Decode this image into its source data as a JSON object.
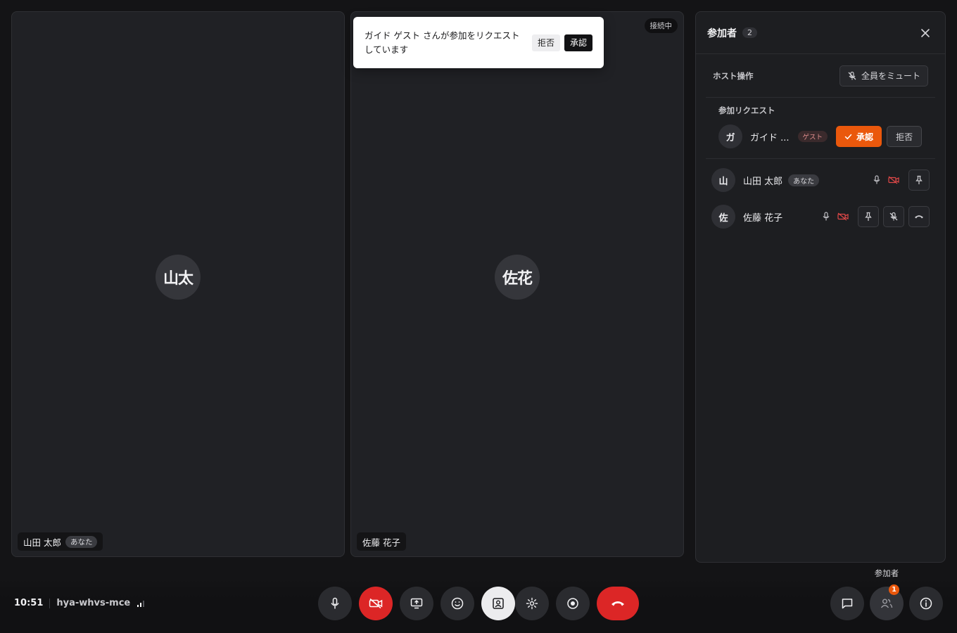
{
  "tiles": [
    {
      "initials": "山太",
      "name": "山田 太郎",
      "you_badge": "あなた"
    },
    {
      "initials": "佐花",
      "name": "佐藤 花子",
      "status": "接続中"
    }
  ],
  "toast": {
    "message": "ガイド ゲスト さんが参加をリクエストしています",
    "reject_label": "拒否",
    "approve_label": "承認"
  },
  "panel": {
    "title": "参加者",
    "count": "2",
    "host_label": "ホスト操作",
    "mute_all_label": "全員をミュート",
    "requests_label": "参加リクエスト",
    "request": {
      "initial": "ガ",
      "name": "ガイド ...",
      "guest_badge": "ゲスト",
      "approve_label": "承認",
      "reject_label": "拒否"
    },
    "participants": [
      {
        "initial": "山",
        "name": "山田 太郎",
        "you_badge": "あなた"
      },
      {
        "initial": "佐",
        "name": "佐藤 花子"
      }
    ]
  },
  "bottom": {
    "time": "10:51",
    "meeting_code": "hya-whvs-mce",
    "tooltip": "参加者",
    "participants_notification": "1"
  },
  "colors": {
    "accent": "#ea580c",
    "danger": "#dc2626",
    "background": "#141416",
    "tile": "#202125"
  }
}
